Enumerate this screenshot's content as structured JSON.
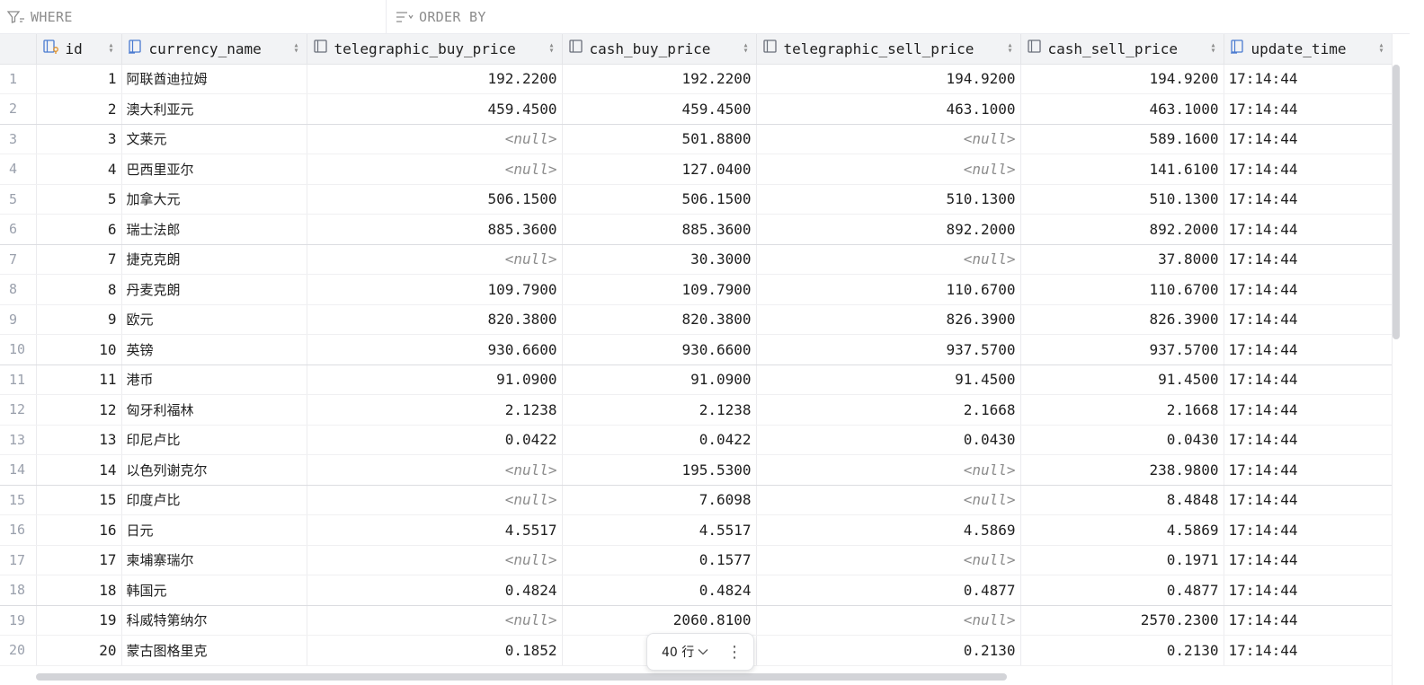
{
  "filter": {
    "where_label": "WHERE",
    "order_label": "ORDER BY"
  },
  "columns": [
    {
      "label": "id",
      "icon": "key-column-icon"
    },
    {
      "label": "currency_name",
      "icon": "index-column-icon"
    },
    {
      "label": "telegraphic_buy_price",
      "icon": "column-icon"
    },
    {
      "label": "cash_buy_price",
      "icon": "column-icon"
    },
    {
      "label": "telegraphic_sell_price",
      "icon": "column-icon"
    },
    {
      "label": "cash_sell_price",
      "icon": "column-icon"
    },
    {
      "label": "update_time",
      "icon": "index-column-icon"
    }
  ],
  "rows": [
    {
      "n": "1",
      "id": "1",
      "name": "阿联酋迪拉姆",
      "tb": "192.2200",
      "cb": "192.2200",
      "ts": "194.9200",
      "cs": "194.9200",
      "t": "17:14:44"
    },
    {
      "n": "2",
      "id": "2",
      "name": "澳大利亚元",
      "tb": "459.4500",
      "cb": "459.4500",
      "ts": "463.1000",
      "cs": "463.1000",
      "t": "17:14:44"
    },
    {
      "n": "3",
      "id": "3",
      "name": "文莱元",
      "tb": "<null>",
      "cb": "501.8800",
      "ts": "<null>",
      "cs": "589.1600",
      "t": "17:14:44"
    },
    {
      "n": "4",
      "id": "4",
      "name": "巴西里亚尔",
      "tb": "<null>",
      "cb": "127.0400",
      "ts": "<null>",
      "cs": "141.6100",
      "t": "17:14:44"
    },
    {
      "n": "5",
      "id": "5",
      "name": "加拿大元",
      "tb": "506.1500",
      "cb": "506.1500",
      "ts": "510.1300",
      "cs": "510.1300",
      "t": "17:14:44"
    },
    {
      "n": "6",
      "id": "6",
      "name": "瑞士法郎",
      "tb": "885.3600",
      "cb": "885.3600",
      "ts": "892.2000",
      "cs": "892.2000",
      "t": "17:14:44"
    },
    {
      "n": "7",
      "id": "7",
      "name": "捷克克朗",
      "tb": "<null>",
      "cb": "30.3000",
      "ts": "<null>",
      "cs": "37.8000",
      "t": "17:14:44"
    },
    {
      "n": "8",
      "id": "8",
      "name": "丹麦克朗",
      "tb": "109.7900",
      "cb": "109.7900",
      "ts": "110.6700",
      "cs": "110.6700",
      "t": "17:14:44"
    },
    {
      "n": "9",
      "id": "9",
      "name": "欧元",
      "tb": "820.3800",
      "cb": "820.3800",
      "ts": "826.3900",
      "cs": "826.3900",
      "t": "17:14:44"
    },
    {
      "n": "10",
      "id": "10",
      "name": "英镑",
      "tb": "930.6600",
      "cb": "930.6600",
      "ts": "937.5700",
      "cs": "937.5700",
      "t": "17:14:44"
    },
    {
      "n": "11",
      "id": "11",
      "name": "港币",
      "tb": "91.0900",
      "cb": "91.0900",
      "ts": "91.4500",
      "cs": "91.4500",
      "t": "17:14:44"
    },
    {
      "n": "12",
      "id": "12",
      "name": "匈牙利福林",
      "tb": "2.1238",
      "cb": "2.1238",
      "ts": "2.1668",
      "cs": "2.1668",
      "t": "17:14:44"
    },
    {
      "n": "13",
      "id": "13",
      "name": "印尼卢比",
      "tb": "0.0422",
      "cb": "0.0422",
      "ts": "0.0430",
      "cs": "0.0430",
      "t": "17:14:44"
    },
    {
      "n": "14",
      "id": "14",
      "name": "以色列谢克尔",
      "tb": "<null>",
      "cb": "195.5300",
      "ts": "<null>",
      "cs": "238.9800",
      "t": "17:14:44"
    },
    {
      "n": "15",
      "id": "15",
      "name": "印度卢比",
      "tb": "<null>",
      "cb": "7.6098",
      "ts": "<null>",
      "cs": "8.4848",
      "t": "17:14:44"
    },
    {
      "n": "16",
      "id": "16",
      "name": "日元",
      "tb": "4.5517",
      "cb": "4.5517",
      "ts": "4.5869",
      "cs": "4.5869",
      "t": "17:14:44"
    },
    {
      "n": "17",
      "id": "17",
      "name": "柬埔寨瑞尔",
      "tb": "<null>",
      "cb": "0.1577",
      "ts": "<null>",
      "cs": "0.1971",
      "t": "17:14:44"
    },
    {
      "n": "18",
      "id": "18",
      "name": "韩国元",
      "tb": "0.4824",
      "cb": "0.4824",
      "ts": "0.4877",
      "cs": "0.4877",
      "t": "17:14:44"
    },
    {
      "n": "19",
      "id": "19",
      "name": "科威特第纳尔",
      "tb": "<null>",
      "cb": "2060.8100",
      "ts": "<null>",
      "cs": "2570.2300",
      "t": "17:14:44"
    },
    {
      "n": "20",
      "id": "20",
      "name": "蒙古图格里克",
      "tb": "0.1852",
      "cb": "",
      "ts": "0.2130",
      "cs": "0.2130",
      "t": "17:14:44"
    }
  ],
  "pager": {
    "count_label": "40 行",
    "more_label": "⋮"
  }
}
